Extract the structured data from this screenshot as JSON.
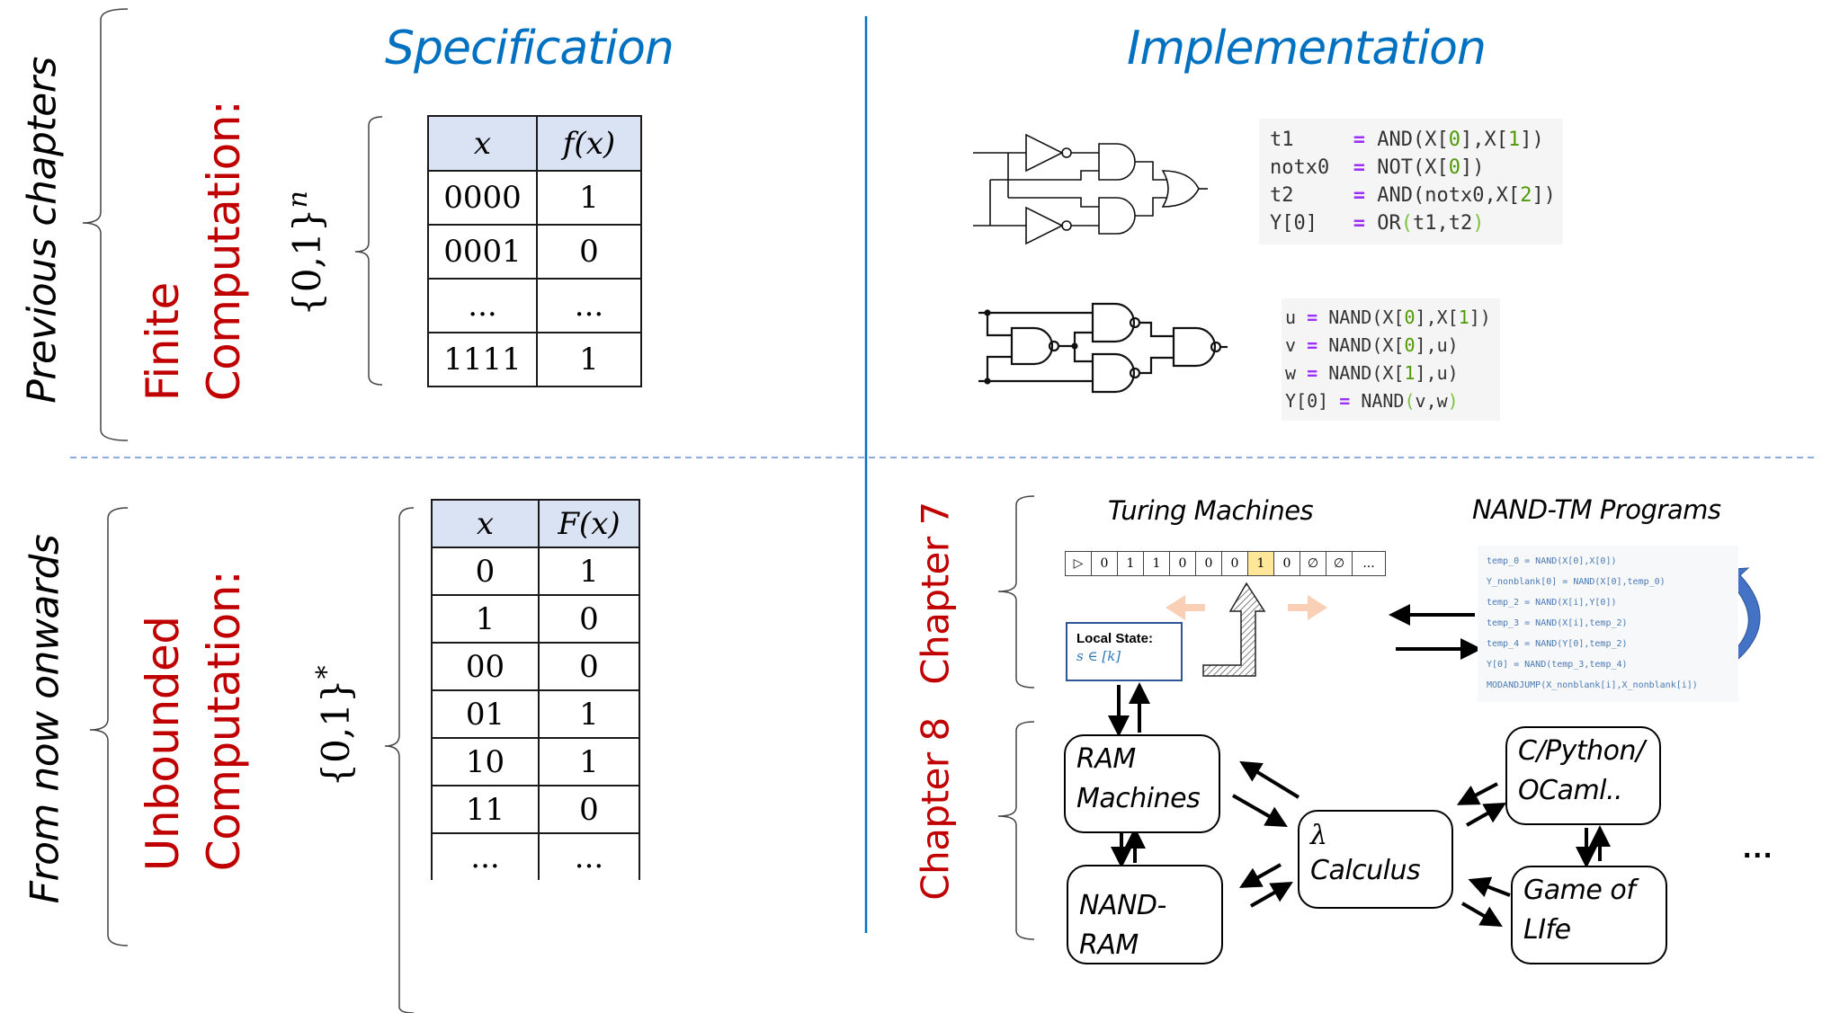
{
  "headings": {
    "specification": "Specification",
    "implementation": "Implementation"
  },
  "sections": {
    "previous": {
      "side_label": "Previous chapters",
      "category_line1": "Finite",
      "category_line2": "Computation:",
      "domain_base": "{0,1}",
      "domain_sup": "n",
      "table": {
        "headers": [
          "x",
          "f(x)"
        ],
        "rows": [
          [
            "0000",
            "1"
          ],
          [
            "0001",
            "0"
          ],
          [
            "...",
            "..."
          ],
          [
            "1111",
            "1"
          ]
        ]
      }
    },
    "onwards": {
      "side_label": "From now onwards",
      "category_line1": "Unbounded",
      "category_line2": "Computation:",
      "domain_base": "{0,1}",
      "domain_sup": "*",
      "table": {
        "headers": [
          "x",
          "F(x)"
        ],
        "rows": [
          [
            "0",
            "1"
          ],
          [
            "1",
            "0"
          ],
          [
            "00",
            "0"
          ],
          [
            "01",
            "1"
          ],
          [
            "10",
            "1"
          ],
          [
            "11",
            "0"
          ],
          [
            "...",
            "..."
          ]
        ]
      }
    }
  },
  "implementation": {
    "circuit_code": [
      {
        "lhs": "t1    ",
        "op": "=",
        "rhs": [
          [
            "AND(X[",
            ""
          ],
          [
            "0",
            "num"
          ],
          [
            "],X[",
            ""
          ],
          [
            "1",
            "num"
          ],
          [
            "])",
            ""
          ]
        ]
      },
      {
        "lhs": "notx0 ",
        "op": "=",
        "rhs": [
          [
            "NOT(X[",
            ""
          ],
          [
            "0",
            "num"
          ],
          [
            "])",
            ""
          ]
        ]
      },
      {
        "lhs": "t2    ",
        "op": "=",
        "rhs": [
          [
            "AND(notx0,X[",
            ""
          ],
          [
            "2",
            "num"
          ],
          [
            "])",
            ""
          ]
        ]
      },
      {
        "lhs": "Y[0]  ",
        "op": "=",
        "rhs": [
          [
            "OR",
            ""
          ],
          [
            "(",
            "par"
          ],
          [
            "t1,t2",
            ""
          ],
          [
            ")",
            "par"
          ]
        ]
      }
    ],
    "nand_code": [
      {
        "lhs": "u",
        "op": "=",
        "rhs": [
          [
            "NAND(X[",
            ""
          ],
          [
            "0",
            "num"
          ],
          [
            "],X[",
            ""
          ],
          [
            "1",
            "num"
          ],
          [
            "])",
            ""
          ]
        ]
      },
      {
        "lhs": "v",
        "op": "=",
        "rhs": [
          [
            "NAND(X[",
            ""
          ],
          [
            "0",
            "num"
          ],
          [
            "],u)",
            ""
          ]
        ]
      },
      {
        "lhs": "w",
        "op": "=",
        "rhs": [
          [
            "NAND(X[",
            ""
          ],
          [
            "1",
            "num"
          ],
          [
            "],u)",
            ""
          ]
        ]
      },
      {
        "lhs": "Y[0]",
        "op": "=",
        "rhs": [
          [
            "NAND",
            ""
          ],
          [
            "(",
            "par"
          ],
          [
            "v,w",
            ""
          ],
          [
            ")",
            "par"
          ]
        ]
      }
    ]
  },
  "chapter7": {
    "label": "Chapter 7",
    "turing_title": "Turing Machines",
    "tape": [
      "▷",
      "0",
      "1",
      "1",
      "0",
      "0",
      "0",
      "1",
      "0",
      "∅",
      "∅",
      "..."
    ],
    "head_index": 7,
    "local_state_title": "Local State:",
    "local_state_expr": "s ∈ [k]",
    "nandtm_title": "NAND-TM Programs",
    "nandtm_code": [
      "temp_0 = NAND(X[0],X[0])",
      "Y_nonblank[0] = NAND(X[0],temp_0)",
      "temp_2 = NAND(X[i],Y[0])",
      "temp_3 = NAND(X[i],temp_2)",
      "temp_4 = NAND(Y[0],temp_2)",
      "Y[0] = NAND(temp_3,temp_4)",
      "MODANDJUMP(X_nonblank[i],X_nonblank[i])"
    ]
  },
  "chapter8": {
    "label": "Chapter 8",
    "boxes": {
      "ram": "RAM\nMachines",
      "nandram": "NAND-\nRAM",
      "lambda_symbol": "λ",
      "lambda_text": "Calculus",
      "cpython": "C/Python/\nOCaml..",
      "gameoflife": "Game of\nLIfe"
    },
    "more": "..."
  },
  "colors": {
    "heading_blue": "#0070c0",
    "label_red": "#c00000",
    "table_header": "#dae3f3",
    "head_cell": "#ffe699",
    "divider": "#0070c0",
    "dashed_divider": "#8faadc"
  }
}
